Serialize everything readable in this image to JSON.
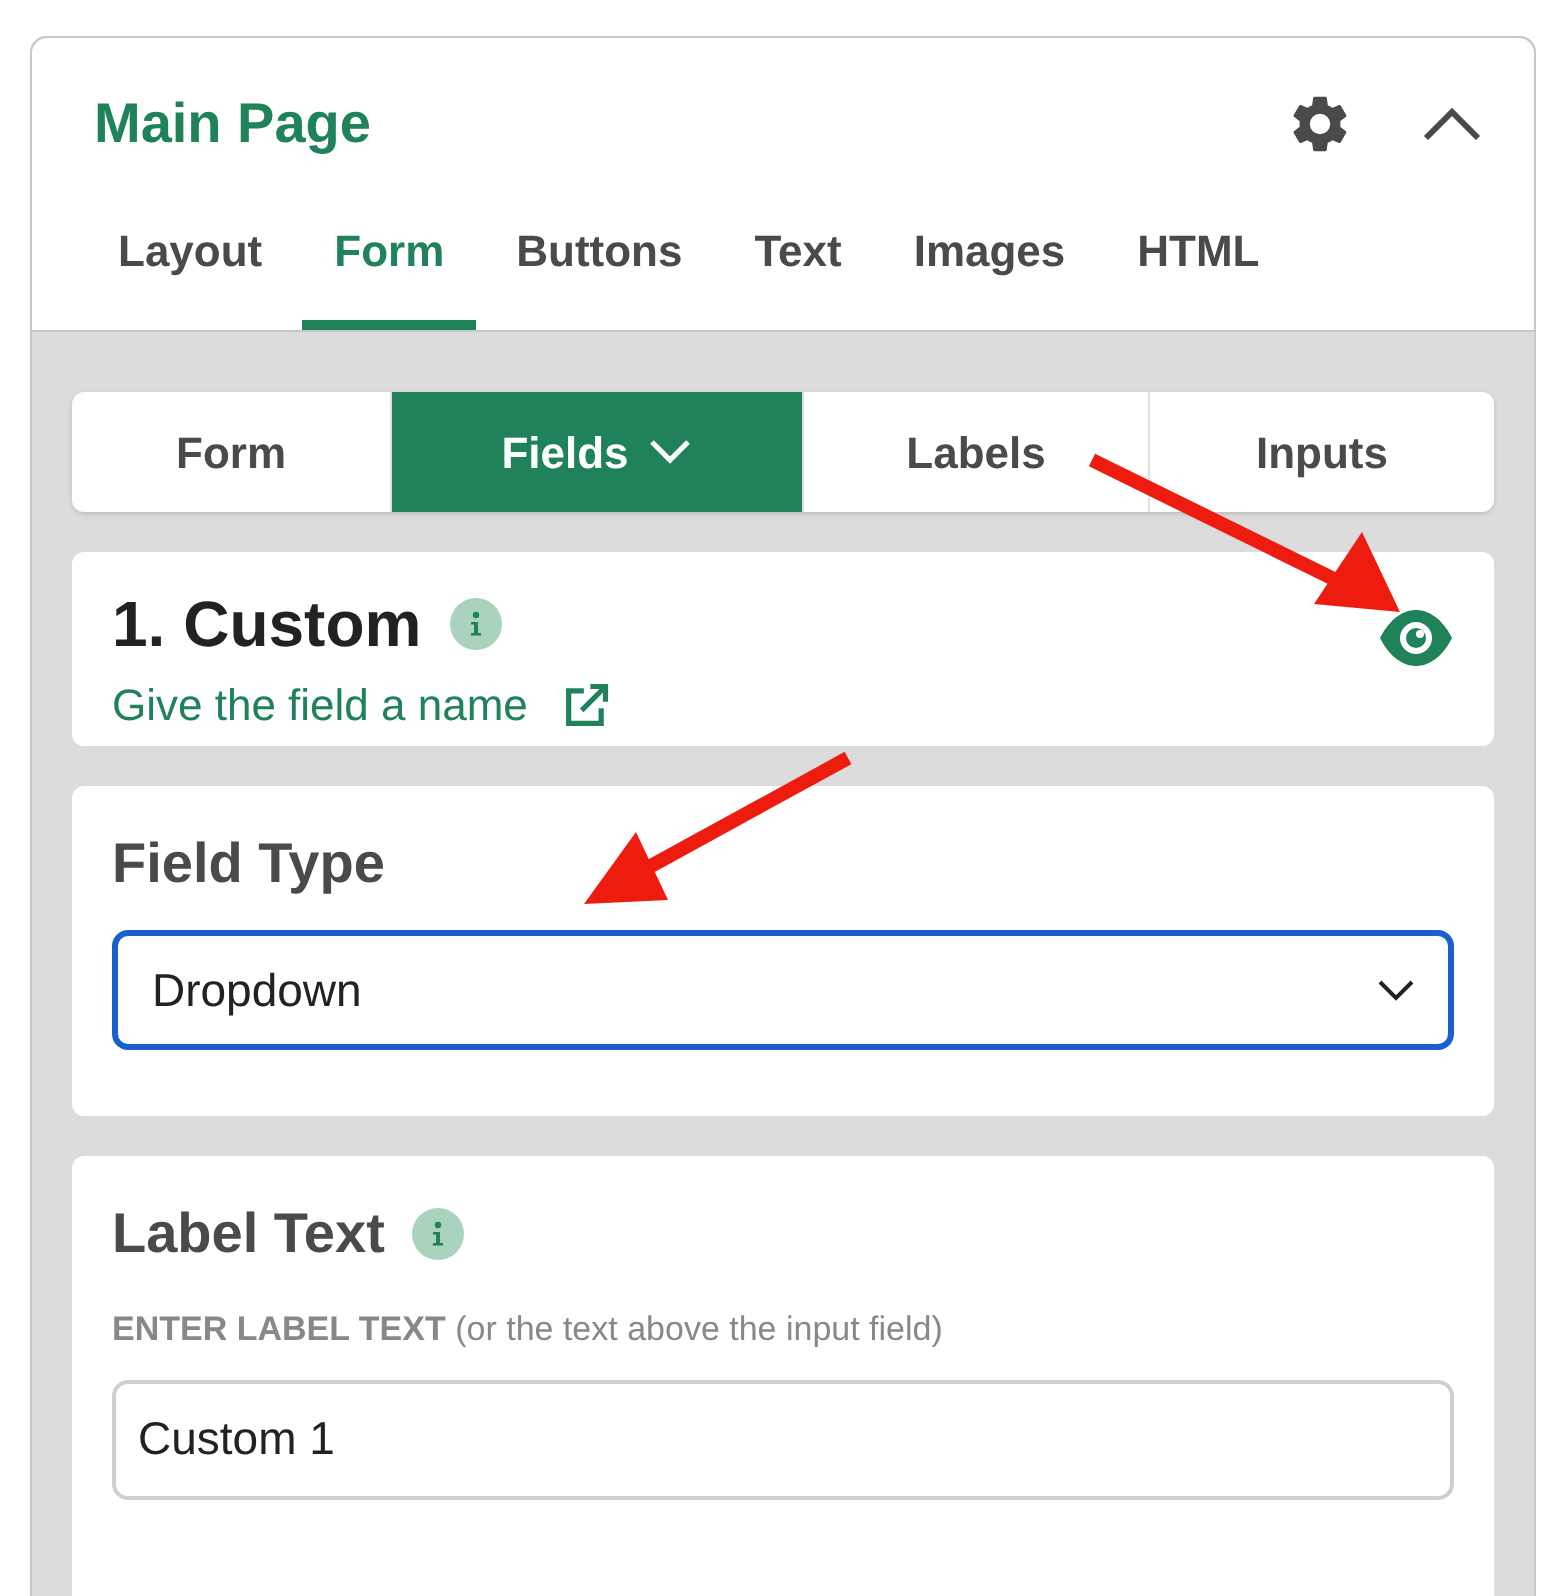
{
  "panel": {
    "title": "Main Page"
  },
  "tabs": [
    {
      "label": "Layout",
      "selected": false
    },
    {
      "label": "Form",
      "selected": true
    },
    {
      "label": "Buttons",
      "selected": false
    },
    {
      "label": "Text",
      "selected": false
    },
    {
      "label": "Images",
      "selected": false
    },
    {
      "label": "HTML",
      "selected": false
    }
  ],
  "subtabs": [
    {
      "label": "Form",
      "selected": false,
      "has_caret": false
    },
    {
      "label": "Fields",
      "selected": true,
      "has_caret": true
    },
    {
      "label": "Labels",
      "selected": false,
      "has_caret": false
    },
    {
      "label": "Inputs",
      "selected": false,
      "has_caret": false
    }
  ],
  "field_card": {
    "title": "1. Custom",
    "link": "Give the field a name",
    "visible": true
  },
  "field_type": {
    "label": "Field Type",
    "value": "Dropdown"
  },
  "label_text": {
    "title": "Label Text",
    "hint": "**ENTER LABEL TEXT** (or the text above the input field)",
    "value": "Custom 1"
  }
}
